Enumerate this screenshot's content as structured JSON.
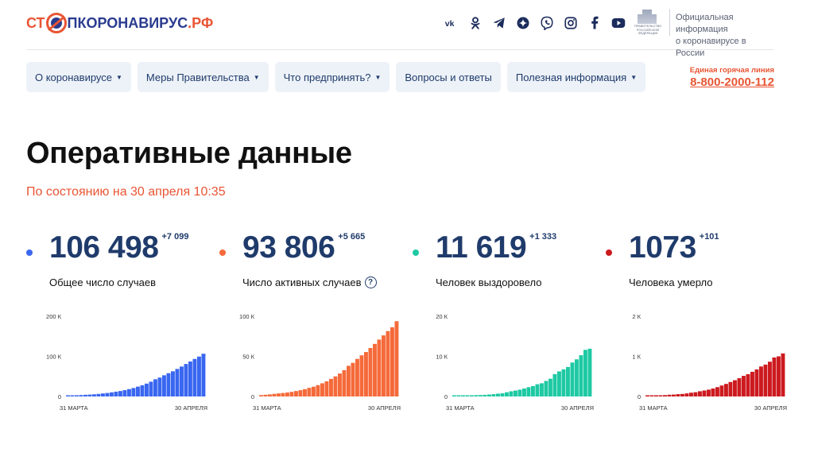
{
  "header": {
    "logo": {
      "part1": "СТ",
      "part2": "ПКОРОНАВИРУС",
      "part3": ".РФ"
    },
    "socials": [
      {
        "name": "vk-icon",
        "glyph": "vk"
      },
      {
        "name": "odnoklassniki-icon",
        "glyph": ""
      },
      {
        "name": "telegram-icon",
        "glyph": ""
      },
      {
        "name": "yandex-zen-icon",
        "glyph": ""
      },
      {
        "name": "viber-icon",
        "glyph": ""
      },
      {
        "name": "instagram-icon",
        "glyph": ""
      },
      {
        "name": "facebook-icon",
        "glyph": "f"
      },
      {
        "name": "youtube-icon",
        "glyph": ""
      }
    ],
    "gov_emblem_text": "ПРАВИТЕЛЬСТВО РОССИЙСКОЙ ФЕДЕРАЦИИ",
    "gov_text_line1": "Официальная информация",
    "gov_text_line2": "о коронавирусе в России"
  },
  "nav": {
    "items": [
      {
        "label": "О коронавирусе",
        "dropdown": true
      },
      {
        "label": "Меры Правительства",
        "dropdown": true
      },
      {
        "label": "Что предпринять?",
        "dropdown": true
      },
      {
        "label": "Вопросы и ответы",
        "dropdown": false
      },
      {
        "label": "Полезная информация",
        "dropdown": true
      }
    ],
    "caret": "▼"
  },
  "hotline": {
    "label": "Единая горячая линия",
    "number": "8-800-2000-112"
  },
  "page": {
    "title": "Оперативные данные",
    "subtitle": "По состоянию на 30 апреля 10:35"
  },
  "stats": [
    {
      "value": "106 498",
      "delta": "+7 099",
      "label": "Общее число случаев",
      "color": "#3a67f0",
      "help": false
    },
    {
      "value": "93 806",
      "delta": "+5 665",
      "label": "Число активных случаев",
      "color": "#f56a3a",
      "help": true,
      "help_glyph": "?"
    },
    {
      "value": "11 619",
      "delta": "+1 333",
      "label": "Человек выздоровело",
      "color": "#1ec9a3",
      "help": false
    },
    {
      "value": "1073",
      "delta": "+101",
      "label": "Человека умерло",
      "color": "#cc1a1f",
      "help": false
    }
  ],
  "chart_data": [
    {
      "type": "bar",
      "color": "#3a67f0",
      "x_start_label": "31 МАРТА",
      "x_end_label": "30 АПРЕЛЯ",
      "yticks": [
        {
          "v": 0,
          "label": "0"
        },
        {
          "v": 100000,
          "label": "100 К"
        },
        {
          "v": 200000,
          "label": "200 К"
        }
      ],
      "ylim": [
        0,
        200000
      ],
      "values": [
        1836,
        2337,
        2777,
        3548,
        4149,
        4731,
        5389,
        6343,
        7497,
        8672,
        10131,
        11917,
        13584,
        15770,
        18328,
        21102,
        24490,
        27938,
        32008,
        36793,
        42853,
        47121,
        52763,
        57999,
        62773,
        68622,
        74588,
        80949,
        87147,
        93558,
        99399,
        106498
      ]
    },
    {
      "type": "bar",
      "color": "#f56a3a",
      "x_start_label": "31 МАРТА",
      "x_end_label": "30 АПРЕЛЯ",
      "yticks": [
        {
          "v": 0,
          "label": "0"
        },
        {
          "v": 50000,
          "label": "50 К"
        },
        {
          "v": 100000,
          "label": "100 К"
        }
      ],
      "ylim": [
        0,
        100000
      ],
      "values": [
        1700,
        2150,
        2560,
        3250,
        3780,
        4300,
        4880,
        5740,
        6760,
        7800,
        9100,
        10700,
        12150,
        14100,
        16400,
        18900,
        21900,
        25000,
        28600,
        32800,
        38200,
        41900,
        46800,
        51300,
        55400,
        60400,
        65500,
        70900,
        76100,
        81500,
        86200,
        93806
      ]
    },
    {
      "type": "bar",
      "color": "#1ec9a3",
      "x_start_label": "31 МАРТА",
      "x_end_label": "30 АПРЕЛЯ",
      "yticks": [
        {
          "v": 0,
          "label": "0"
        },
        {
          "v": 10000,
          "label": "10 К"
        },
        {
          "v": 20000,
          "label": "20 К"
        }
      ],
      "ylim": [
        0,
        20000
      ],
      "values": [
        66,
        121,
        190,
        235,
        281,
        333,
        355,
        406,
        494,
        580,
        698,
        793,
        1045,
        1291,
        1470,
        1694,
        1986,
        2304,
        2590,
        3045,
        3291,
        3873,
        4420,
        5568,
        6250,
        6767,
        7346,
        8456,
        9254,
        10286,
        11619,
        11900
      ]
    },
    {
      "type": "bar",
      "color": "#cc1a1f",
      "x_start_label": "31 МАРТА",
      "x_end_label": "30 АПРЕЛЯ",
      "yticks": [
        {
          "v": 0,
          "label": "0"
        },
        {
          "v": 1000,
          "label": "1 К"
        },
        {
          "v": 2000,
          "label": "2 К"
        }
      ],
      "ylim": [
        0,
        2000
      ],
      "values": [
        9,
        17,
        24,
        30,
        34,
        43,
        47,
        58,
        63,
        76,
        94,
        106,
        130,
        148,
        170,
        198,
        232,
        273,
        313,
        361,
        405,
        456,
        513,
        555,
        615,
        674,
        747,
        794,
        867,
        972,
        1000,
        1073
      ]
    }
  ]
}
